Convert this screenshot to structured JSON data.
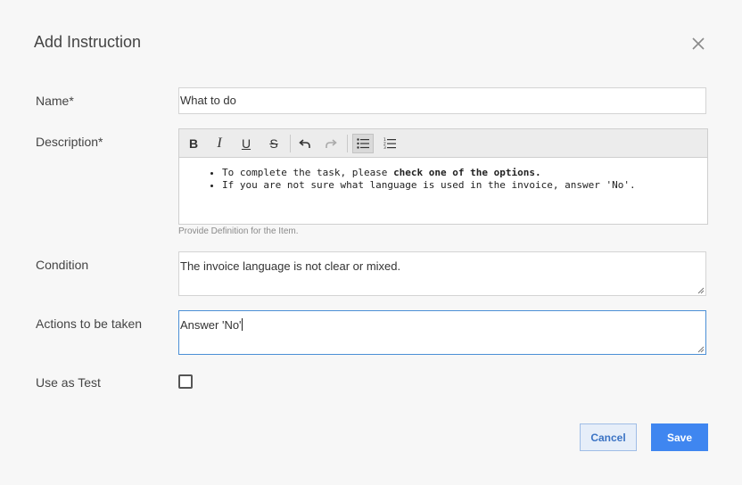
{
  "dialog": {
    "title": "Add Instruction"
  },
  "form": {
    "name_label": "Name*",
    "name_value": "What to do",
    "description_label": "Description*",
    "description_items": {
      "item1_prefix": "To complete the task, please ",
      "item1_bold": "check one of the options.",
      "item2": "If you are not sure what language is used in the invoice, answer 'No'."
    },
    "description_helper": "Provide Definition for the Item.",
    "condition_label": "Condition",
    "condition_value": "The invoice language is not clear or mixed.",
    "actions_label": "Actions to be taken",
    "actions_value": "Answer 'No'",
    "use_as_test_label": "Use as Test",
    "use_as_test_checked": false
  },
  "toolbar": {
    "bold": "B",
    "italic": "I",
    "underline": "U",
    "strikethrough": "S",
    "icons": [
      "bold-icon",
      "italic-icon",
      "underline-icon",
      "strikethrough-icon",
      "undo-icon",
      "redo-icon",
      "bulleted-list-icon",
      "numbered-list-icon"
    ],
    "active": "bulleted-list"
  },
  "buttons": {
    "cancel": "Cancel",
    "save": "Save"
  },
  "colors": {
    "accent": "#3f86f0",
    "focus_border": "#4b8fd6"
  }
}
